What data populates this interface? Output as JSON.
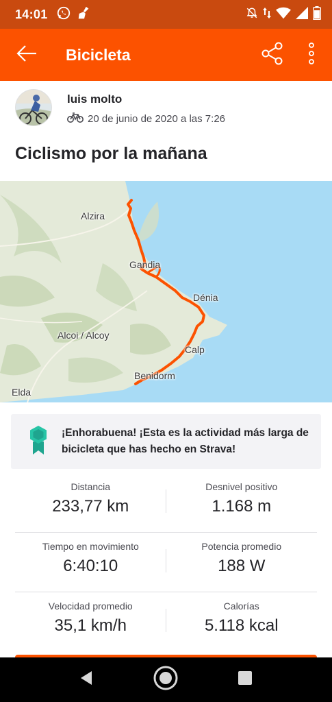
{
  "status_bar": {
    "time": "14:01"
  },
  "app_bar": {
    "title": "Bicicleta"
  },
  "athlete": {
    "name": "luis molto",
    "date": "20 de junio de 2020 a las 7:26"
  },
  "activity": {
    "title": "Ciclismo por la mañana"
  },
  "map": {
    "labels": {
      "alzira": "Alzira",
      "gandia": "Gandia",
      "denia": "Dénia",
      "alcoi": "Alcoi / Alcoy",
      "calp": "Calp",
      "benidorm": "Benidorm",
      "elda": "Elda"
    },
    "route_color": "#fc5200",
    "sea_color": "#a8dbf5"
  },
  "achievement": {
    "text": "¡Enhorabuena! ¡Esta es la actividad más larga de bicicleta que has hecho en Strava!"
  },
  "stats": [
    {
      "left_label": "Distancia",
      "left_value": "233,77 km",
      "right_label": "Desnivel positivo",
      "right_value": "1.168 m"
    },
    {
      "left_label": "Tiempo en movimiento",
      "left_value": "6:40:10",
      "right_label": "Potencia promedio",
      "right_value": "188 W"
    },
    {
      "left_label": "Velocidad promedio",
      "left_value": "35,1 km/h",
      "right_label": "Calorías",
      "right_value": "5.118 kcal"
    }
  ],
  "colors": {
    "brand": "#fc5200",
    "status_bar": "#c94a0f"
  },
  "icons": [
    "whatsapp-icon",
    "cleaner-icon",
    "mute-icon",
    "data-arrows-icon",
    "wifi-icon",
    "signal-icon",
    "battery-icon",
    "back-arrow-icon",
    "share-icon",
    "more-vert-icon",
    "bike-icon",
    "achievement-badge-icon",
    "nav-back-icon",
    "nav-home-icon",
    "nav-recents-icon"
  ]
}
